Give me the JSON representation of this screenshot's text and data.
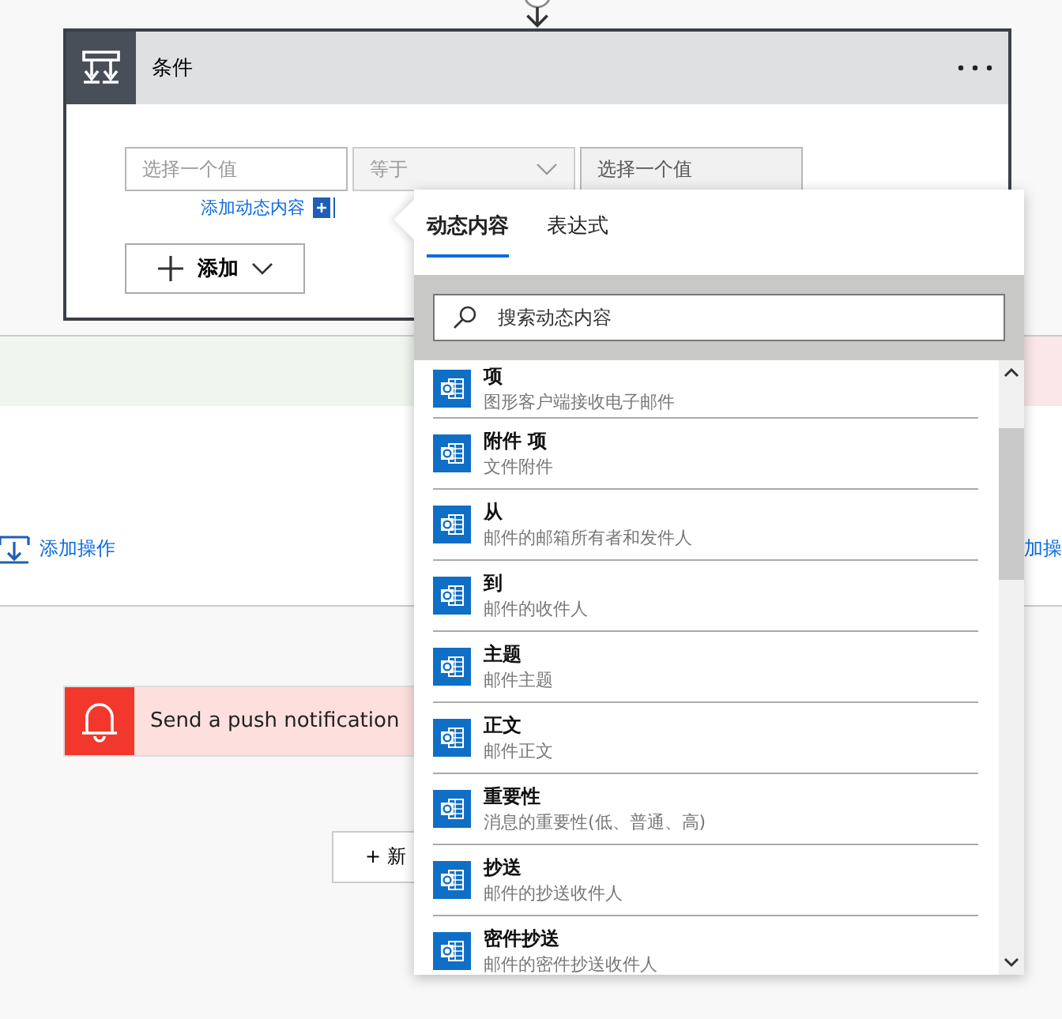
{
  "condition_card": {
    "title": "条件",
    "fields": [
      {
        "kind": "input",
        "placeholder": "选择一个值",
        "active": false
      },
      {
        "kind": "dropdown",
        "value": "等于",
        "disabled": true
      },
      {
        "kind": "input",
        "placeholder": "选择一个值",
        "active": true
      }
    ],
    "add_dynamic_link": "添加动态内容",
    "add_button": "添加"
  },
  "flow": {
    "add_action_left": "添加操作",
    "add_action_right": "加操"
  },
  "push_card": {
    "title": "Send a push notification"
  },
  "new_step_button": "+ 新",
  "popup": {
    "tabs": [
      {
        "label": "动态内容",
        "selected": true
      },
      {
        "label": "表达式",
        "selected": false
      }
    ],
    "search": {
      "placeholder": "搜索动态内容"
    },
    "items": [
      {
        "title": "项",
        "subtitle": "图形客户端接收电子邮件"
      },
      {
        "title": "附件 项",
        "subtitle": "文件附件"
      },
      {
        "title": "从",
        "subtitle": "邮件的邮箱所有者和发件人"
      },
      {
        "title": "到",
        "subtitle": "邮件的收件人"
      },
      {
        "title": "主题",
        "subtitle": "邮件主题"
      },
      {
        "title": "正文",
        "subtitle": "邮件正文"
      },
      {
        "title": "重要性",
        "subtitle": "消息的重要性(低、普通、高)"
      },
      {
        "title": "抄送",
        "subtitle": "邮件的抄送收件人"
      },
      {
        "title": "密件抄送",
        "subtitle": "邮件的密件抄送收件人"
      }
    ]
  }
}
